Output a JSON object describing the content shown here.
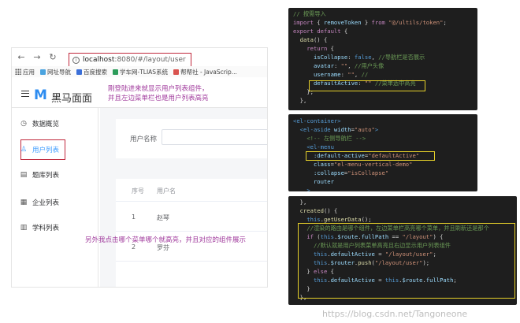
{
  "browser": {
    "url_host": "localhost",
    "url_path": ":8080/#/layout/user",
    "bookmarks": [
      "应用",
      "网址导航",
      "百度搜索",
      "学车网-TLIAS系统",
      "帮帮社 - JavaScrip..."
    ],
    "brand": "黑马面面",
    "logo": "M",
    "annotation_top": "刚登陆进来就显示用户列表组件，\n并且左边菜单栏也是用户列表高亮",
    "annotation_bottom": "另外我点击哪个菜单哪个就高亮，并且对应的组件展示",
    "menu": [
      {
        "label": "数据概览",
        "icon": "clock-icon"
      },
      {
        "label": "用户列表",
        "icon": "user-icon",
        "active": true
      },
      {
        "label": "题库列表",
        "icon": "list-icon"
      },
      {
        "label": "企业列表",
        "icon": "building-icon"
      },
      {
        "label": "学科列表",
        "icon": "book-icon"
      }
    ],
    "form": {
      "user_label": "用户名称"
    },
    "table": {
      "headers": [
        "序号",
        "用户名"
      ],
      "rows": [
        [
          "1",
          "赵琴"
        ],
        [
          "2",
          "罗芬"
        ]
      ]
    },
    "colors": {
      "accent": "#409eff",
      "highlight_box": "#c0283c",
      "annotation": "#a03a9c"
    }
  },
  "code_panels": [
    {
      "lines": [
        [
          [
            "c-comment",
            "// 按需导入"
          ]
        ],
        [
          [
            "c-kw",
            "import"
          ],
          [
            "c-plain",
            " { "
          ],
          [
            "c-key",
            "removeToken"
          ],
          [
            "c-plain",
            " } "
          ],
          [
            "c-kw",
            "from"
          ],
          [
            "c-str",
            " \"@/ultils/token\""
          ],
          [
            "c-plain",
            ";"
          ]
        ],
        [
          [
            "c-kw",
            "export default"
          ],
          [
            "c-plain",
            " {"
          ]
        ],
        [
          [
            "c-plain",
            "  "
          ],
          [
            "c-fn",
            "data"
          ],
          [
            "c-plain",
            "() {"
          ]
        ],
        [
          [
            "c-plain",
            "    "
          ],
          [
            "c-kw",
            "return"
          ],
          [
            "c-plain",
            " {"
          ]
        ],
        [
          [
            "c-plain",
            "      "
          ],
          [
            "c-key",
            "isCollapse"
          ],
          [
            "c-plain",
            ": "
          ],
          [
            "c-tag",
            "false"
          ],
          [
            "c-plain",
            ", "
          ],
          [
            "c-comment",
            "//导航栏是否展示"
          ]
        ],
        [
          [
            "c-plain",
            "      "
          ],
          [
            "c-key",
            "avatar"
          ],
          [
            "c-plain",
            ": "
          ],
          [
            "c-str",
            "\"\""
          ],
          [
            "c-plain",
            ", "
          ],
          [
            "c-comment",
            "//用户头像"
          ]
        ],
        [
          [
            "c-plain",
            "      "
          ],
          [
            "c-key",
            "username"
          ],
          [
            "c-plain",
            ": "
          ],
          [
            "c-str",
            "\"\""
          ],
          [
            "c-plain",
            ", "
          ],
          [
            "c-comment",
            "//"
          ]
        ],
        [
          [
            "c-plain",
            "      "
          ],
          [
            "c-key",
            "defaultActive"
          ],
          [
            "c-plain",
            ": "
          ],
          [
            "c-str",
            "\"\""
          ],
          [
            "c-plain",
            " "
          ],
          [
            "c-comment",
            "//菜单选中高亮"
          ]
        ],
        [
          [
            "c-plain",
            "    };"
          ]
        ],
        [
          [
            "c-plain",
            "  },"
          ]
        ]
      ]
    },
    {
      "lines": [
        [
          [
            "c-tag",
            "<el-container>"
          ]
        ],
        [
          [
            "c-plain",
            "  "
          ],
          [
            "c-tag",
            "<el-aside"
          ],
          [
            "c-attr",
            " width"
          ],
          [
            "c-plain",
            "="
          ],
          [
            "c-str",
            "\"auto\""
          ],
          [
            "c-tag",
            ">"
          ]
        ],
        [
          [
            "c-plain",
            "    "
          ],
          [
            "c-comment",
            "<!-- 左侧导航栏 -->"
          ]
        ],
        [
          [
            "c-plain",
            "    "
          ],
          [
            "c-tag",
            "<el-menu"
          ]
        ],
        [
          [
            "c-plain",
            "      "
          ],
          [
            "c-attr",
            ":default-active"
          ],
          [
            "c-plain",
            "="
          ],
          [
            "c-str",
            "\"defaultActive\""
          ]
        ],
        [
          [
            "c-plain",
            "      "
          ],
          [
            "c-attr",
            "class"
          ],
          [
            "c-plain",
            "="
          ],
          [
            "c-str",
            "\"el-menu-vertical-demo\""
          ]
        ],
        [
          [
            "c-plain",
            "      "
          ],
          [
            "c-attr",
            ":collapse"
          ],
          [
            "c-plain",
            "="
          ],
          [
            "c-str",
            "\"isCollapse\""
          ]
        ],
        [
          [
            "c-plain",
            "      "
          ],
          [
            "c-attr",
            "router"
          ]
        ],
        [
          [
            "c-plain",
            "    "
          ],
          [
            "c-tag",
            ">"
          ]
        ]
      ]
    },
    {
      "lines": [
        [
          [
            "c-plain",
            "  },"
          ]
        ],
        [
          [
            "c-plain",
            "  "
          ],
          [
            "c-fn",
            "created"
          ],
          [
            "c-plain",
            "() {"
          ]
        ],
        [
          [
            "c-plain",
            "    "
          ],
          [
            "c-this",
            "this"
          ],
          [
            "c-plain",
            "."
          ],
          [
            "c-fn",
            "getUserData"
          ],
          [
            "c-plain",
            "();"
          ]
        ],
        [
          [
            "c-plain",
            "    "
          ],
          [
            "c-comment",
            "//渲染的路由是哪个组件，左边菜单栏高亮哪个菜单，并且刷新还是那个"
          ]
        ],
        [
          [
            "c-plain",
            "    "
          ],
          [
            "c-kw",
            "if"
          ],
          [
            "c-plain",
            " ("
          ],
          [
            "c-this",
            "this"
          ],
          [
            "c-plain",
            "."
          ],
          [
            "c-key",
            "$route"
          ],
          [
            "c-plain",
            "."
          ],
          [
            "c-key",
            "fullPath"
          ],
          [
            "c-plain",
            " == "
          ],
          [
            "c-str",
            "\"/layout\""
          ],
          [
            "c-plain",
            ") {"
          ]
        ],
        [
          [
            "c-plain",
            "      "
          ],
          [
            "c-comment",
            "//默认就是用户列表菜单高亮且右边显示用户列表组件"
          ]
        ],
        [
          [
            "c-plain",
            "      "
          ],
          [
            "c-this",
            "this"
          ],
          [
            "c-plain",
            "."
          ],
          [
            "c-key",
            "defaultActive"
          ],
          [
            "c-plain",
            " = "
          ],
          [
            "c-str",
            "\"/layout/user\""
          ],
          [
            "c-plain",
            ";"
          ]
        ],
        [
          [
            "c-plain",
            "      "
          ],
          [
            "c-this",
            "this"
          ],
          [
            "c-plain",
            "."
          ],
          [
            "c-key",
            "$router"
          ],
          [
            "c-plain",
            "."
          ],
          [
            "c-fn",
            "push"
          ],
          [
            "c-plain",
            "("
          ],
          [
            "c-str",
            "\"/layout/user\""
          ],
          [
            "c-plain",
            ");"
          ]
        ],
        [
          [
            "c-plain",
            "    } "
          ],
          [
            "c-kw",
            "else"
          ],
          [
            "c-plain",
            " {"
          ]
        ],
        [
          [
            "c-plain",
            "      "
          ],
          [
            "c-this",
            "this"
          ],
          [
            "c-plain",
            "."
          ],
          [
            "c-key",
            "defaultActive"
          ],
          [
            "c-plain",
            " = "
          ],
          [
            "c-this",
            "this"
          ],
          [
            "c-plain",
            "."
          ],
          [
            "c-key",
            "$route"
          ],
          [
            "c-plain",
            "."
          ],
          [
            "c-key",
            "fullPath"
          ],
          [
            "c-plain",
            ";"
          ]
        ],
        [
          [
            "c-plain",
            "    }"
          ]
        ],
        [
          [
            "c-plain",
            "  },"
          ]
        ]
      ]
    }
  ],
  "watermark": "https://blog.csdn.net/Tangoneone"
}
